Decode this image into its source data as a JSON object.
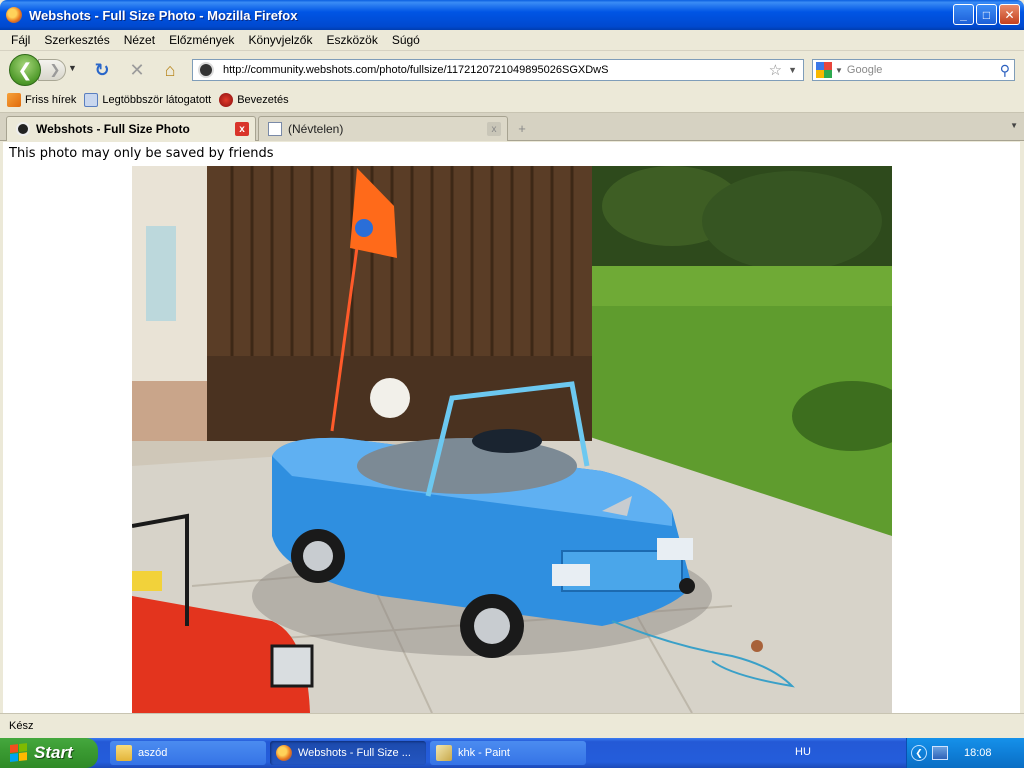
{
  "window": {
    "title": "Webshots - Full Size Photo - Mozilla Firefox",
    "minimize_label": "_",
    "maximize_label": "□",
    "close_label": "✕"
  },
  "menu": [
    "Fájl",
    "Szerkesztés",
    "Nézet",
    "Előzmények",
    "Könyvjelzők",
    "Eszközök",
    "Súgó"
  ],
  "nav": {
    "back_glyph": "❮",
    "forward_glyph": "❯",
    "reload_glyph": "↻",
    "stop_glyph": "✕",
    "home_glyph": "⌂",
    "url": "http://community.webshots.com/photo/fullsize/1172120721049895026SGXDwS",
    "bookmark_star": "☆",
    "search_placeholder": "Google",
    "search_glyph": "⚲"
  },
  "bookmarks": [
    {
      "label": "Friss hírek",
      "icon": "rss-icon"
    },
    {
      "label": "Legtöbbször látogatott",
      "icon": "most-visited-icon"
    },
    {
      "label": "Bevezetés",
      "icon": "getting-started-icon"
    }
  ],
  "tabs": [
    {
      "label": "Webshots - Full Size Photo",
      "active": true
    },
    {
      "label": "(Névtelen)",
      "active": false
    }
  ],
  "tab_controls": {
    "new_tab": "+",
    "close": "x"
  },
  "content": {
    "notice": "This photo may only be saved by friends"
  },
  "status": {
    "text": "Kész"
  },
  "taskbar": {
    "start_label": "Start",
    "tasks": [
      {
        "label": "aszód",
        "icon": "folder-icon",
        "active": false
      },
      {
        "label": "Webshots - Full Size ...",
        "icon": "firefox-icon",
        "active": true
      },
      {
        "label": "khk - Paint",
        "icon": "paint-icon",
        "active": false
      }
    ],
    "language": "HU",
    "clock": "18:08"
  },
  "colors": {
    "titlebar": "#0055e5",
    "taskbar": "#245ddb",
    "start_green": "#3b9b33",
    "car_blue": "#2f8fe0",
    "car_red": "#e3341e",
    "grass": "#5f9c2e"
  }
}
